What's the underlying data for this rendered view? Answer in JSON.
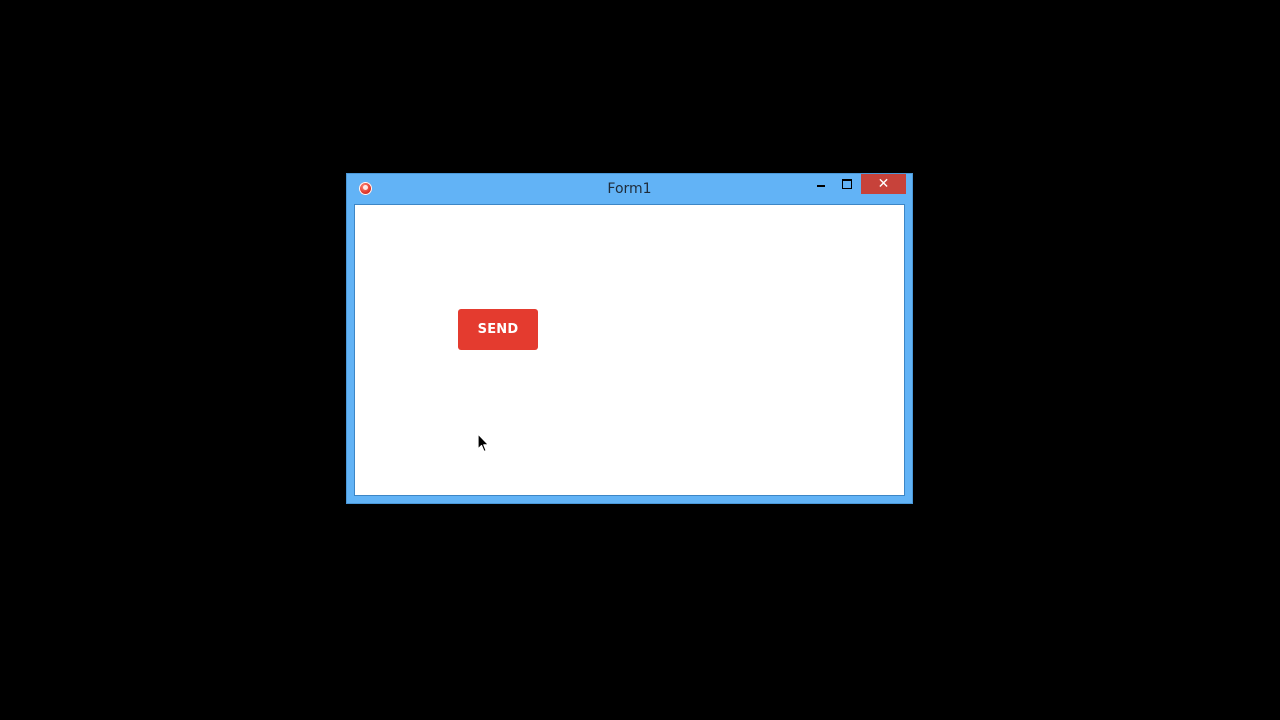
{
  "window": {
    "title": "Form1",
    "controls": {
      "minimize_icon": "minimize-icon",
      "maximize_icon": "maximize-icon",
      "close_glyph": "✕"
    }
  },
  "form": {
    "send_label": "SEND"
  },
  "colors": {
    "desktop": "#000000",
    "window_frame": "#62b3f6",
    "close_button": "#c7423a",
    "send_button": "#e43b2f"
  }
}
